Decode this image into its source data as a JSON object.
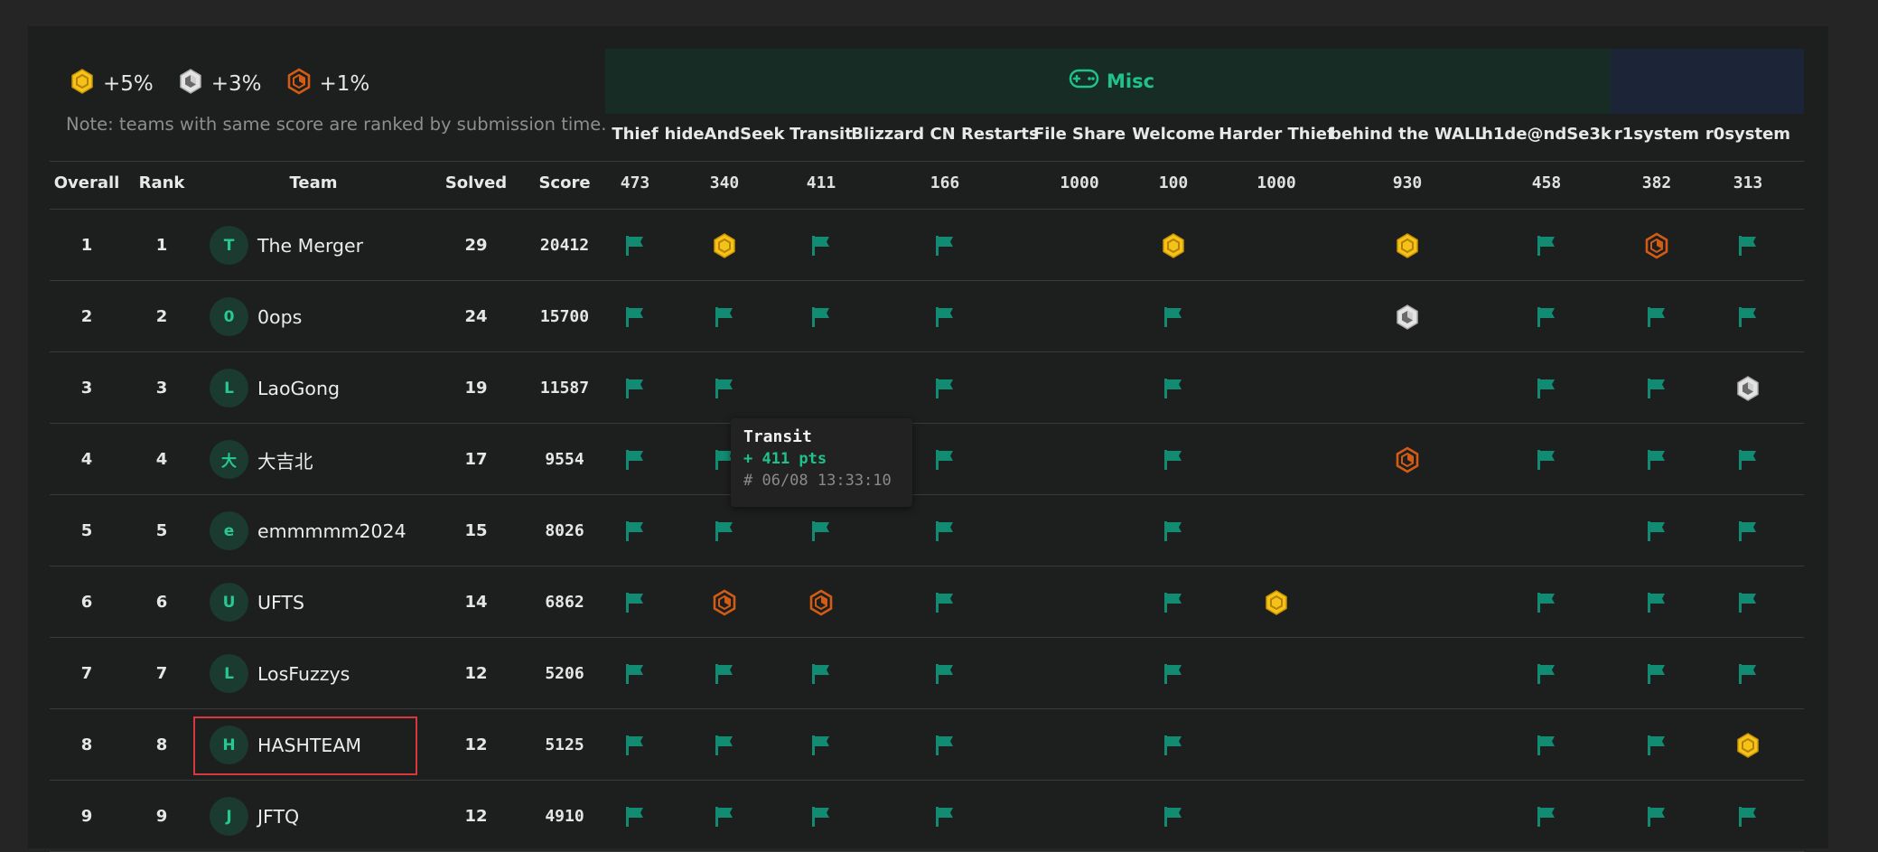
{
  "legend": [
    {
      "medal": "gold",
      "label": "+5%"
    },
    {
      "medal": "silver",
      "label": "+3%"
    },
    {
      "medal": "bronze",
      "label": "+1%"
    }
  ],
  "note": "Note: teams with same score are ranked by submission time.",
  "category": {
    "name": "Misc",
    "icon": "gamepad-icon",
    "color": "#1fc28a"
  },
  "headers": {
    "overall": "Overall",
    "rank": "Rank",
    "team": "Team",
    "solved": "Solved",
    "score": "Score"
  },
  "challenges": [
    {
      "name": "Thief",
      "points": "473"
    },
    {
      "name": "hideAndSeek",
      "points": "340"
    },
    {
      "name": "Transit",
      "points": "411"
    },
    {
      "name": "Blizzard CN Restarts",
      "points": "166"
    },
    {
      "name": "File Share",
      "points": "1000"
    },
    {
      "name": "Welcome",
      "points": "100"
    },
    {
      "name": "Harder Thief",
      "points": "1000"
    },
    {
      "name": "behind the WALL",
      "points": "930"
    },
    {
      "name": "h1de@ndSe3k",
      "points": "458"
    },
    {
      "name": "r1system",
      "points": "382"
    },
    {
      "name": "r0system",
      "points": "313"
    }
  ],
  "teams": [
    {
      "overall": "1",
      "rank": "1",
      "initial": "T",
      "name": "The Merger",
      "solved": "29",
      "score": "20412",
      "cells": [
        "flag",
        "gold",
        "flag",
        "flag",
        "",
        "gold",
        "",
        "gold",
        "flag",
        "bronze",
        "flag"
      ]
    },
    {
      "overall": "2",
      "rank": "2",
      "initial": "0",
      "name": "0ops",
      "solved": "24",
      "score": "15700",
      "cells": [
        "flag",
        "flag",
        "flag",
        "flag",
        "",
        "flag",
        "",
        "silver",
        "flag",
        "flag",
        "flag"
      ]
    },
    {
      "overall": "3",
      "rank": "3",
      "initial": "L",
      "name": "LaoGong",
      "solved": "19",
      "score": "11587",
      "cells": [
        "flag",
        "flag",
        "",
        "flag",
        "",
        "flag",
        "",
        "",
        "flag",
        "flag",
        "silver"
      ]
    },
    {
      "overall": "4",
      "rank": "4",
      "initial": "大",
      "name": "大吉北",
      "solved": "17",
      "score": "9554",
      "cells": [
        "flag",
        "flag",
        "",
        "flag",
        "",
        "flag",
        "",
        "bronze",
        "flag",
        "flag",
        "flag"
      ]
    },
    {
      "overall": "5",
      "rank": "5",
      "initial": "e",
      "name": "emmmmm2024",
      "solved": "15",
      "score": "8026",
      "cells": [
        "flag",
        "flag",
        "flag",
        "flag",
        "",
        "flag",
        "",
        "",
        "",
        "flag",
        "flag"
      ]
    },
    {
      "overall": "6",
      "rank": "6",
      "initial": "U",
      "name": "UFTS",
      "solved": "14",
      "score": "6862",
      "cells": [
        "flag",
        "bronze",
        "bronze",
        "flag",
        "",
        "flag",
        "gold",
        "",
        "flag",
        "flag",
        "flag"
      ]
    },
    {
      "overall": "7",
      "rank": "7",
      "initial": "L",
      "name": "LosFuzzys",
      "solved": "12",
      "score": "5206",
      "cells": [
        "flag",
        "flag",
        "flag",
        "flag",
        "",
        "flag",
        "",
        "",
        "flag",
        "flag",
        "flag"
      ]
    },
    {
      "overall": "8",
      "rank": "8",
      "initial": "H",
      "name": "HASHTEAM",
      "solved": "12",
      "score": "5125",
      "cells": [
        "flag",
        "flag",
        "flag",
        "flag",
        "",
        "flag",
        "",
        "",
        "flag",
        "flag",
        "gold"
      ]
    },
    {
      "overall": "9",
      "rank": "9",
      "initial": "J",
      "name": "JFTQ",
      "solved": "12",
      "score": "4910",
      "cells": [
        "flag",
        "flag",
        "flag",
        "flag",
        "",
        "flag",
        "",
        "",
        "flag",
        "flag",
        "flag"
      ]
    }
  ],
  "tooltip": {
    "title": "Transit",
    "points": "+ 411 pts",
    "time": "# 06/08 13:33:10"
  },
  "colors": {
    "flag": "#118c72",
    "gold": "#f4c21a",
    "silver": "#e3e3e3",
    "bronze": "#d25c16",
    "accent": "#1fc28a",
    "highlight": "#d9383a"
  }
}
